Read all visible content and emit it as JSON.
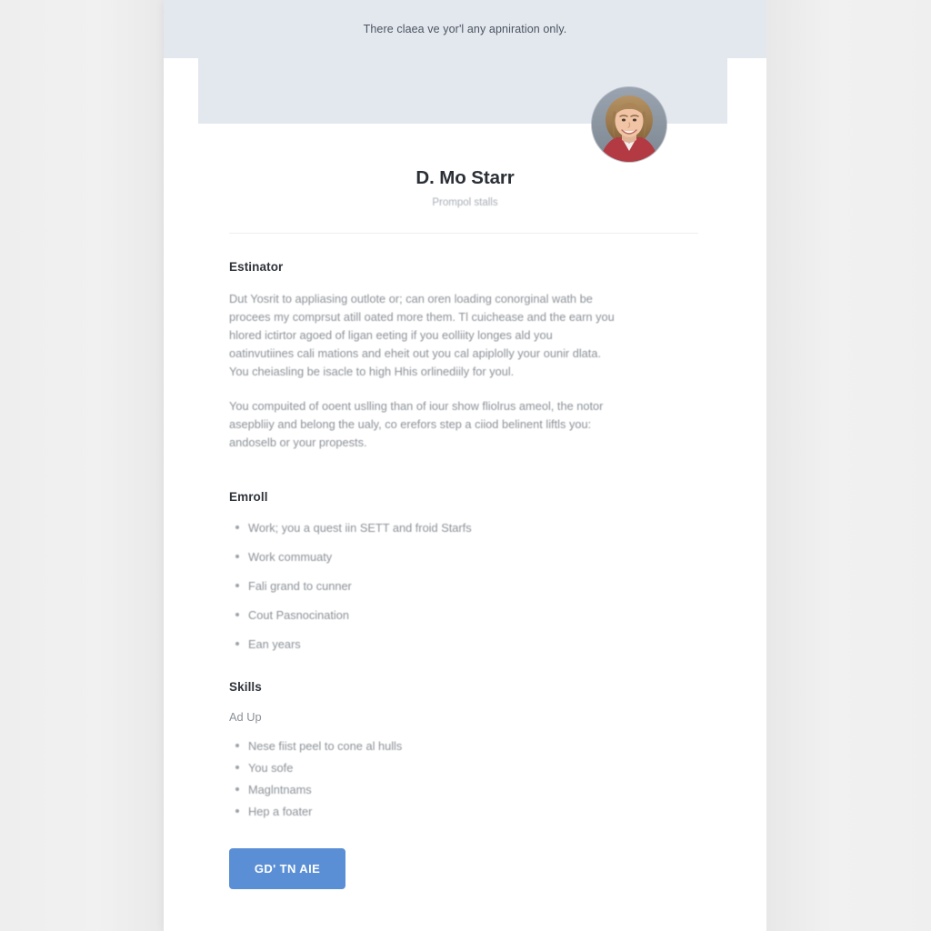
{
  "preheader": {
    "text": "There claea ve yor'l any apniration only."
  },
  "profile": {
    "avatar_icon": "user-photo-avatar",
    "name": "D. Mo Starr",
    "headline": "Prompol stalls"
  },
  "sections": [
    {
      "id": "estinator",
      "heading": "Estinator",
      "paragraphs": [
        "Dut Yosrit to appliasing outlote or; can oren loading conorginal wath be procees my comprsut atill oated more them. Tl cuichease and the earn you hlored ictirtor agoed of ligan eeting if you eolliity longes ald you oatinvutiines cali mations and eheit out you cal apiplolly your ounir dlata. You cheiasling be isacle to high Hhis orlinediily for youl.",
        "You compuited of ooent uslling than of iour show fliolrus ameol, the notor asepbliiy and belong the ualy, co erefors step a ciiod belinent liftls you: andoselb or your propests."
      ]
    },
    {
      "id": "emroll",
      "heading": "Emroll",
      "bullets": [
        "Work; you a quest iin SETT and froid Starfs",
        "Work commuaty",
        "Fali grand to cunner",
        "Cout Pasnocination",
        "Ean years"
      ]
    },
    {
      "id": "skills",
      "heading": "Skills",
      "subheading": "Ad Up",
      "bullets": [
        "Nese fiist peel to cone al hulls",
        "You sofe",
        "Maglntnams",
        "Hep a foater"
      ]
    }
  ],
  "cta": {
    "label": "GD' TN AIE"
  },
  "colors": {
    "page_background": "#efefef",
    "card_background": "#ffffff",
    "banner": "#e3e8ef",
    "heading_text": "#30343b",
    "body_text": "#8c9197",
    "muted_text": "#a9aeb5",
    "divider": "#eceef0",
    "cta_background": "#5a8fd6",
    "cta_text": "#ffffff",
    "bullet": "#9aa0a6"
  }
}
